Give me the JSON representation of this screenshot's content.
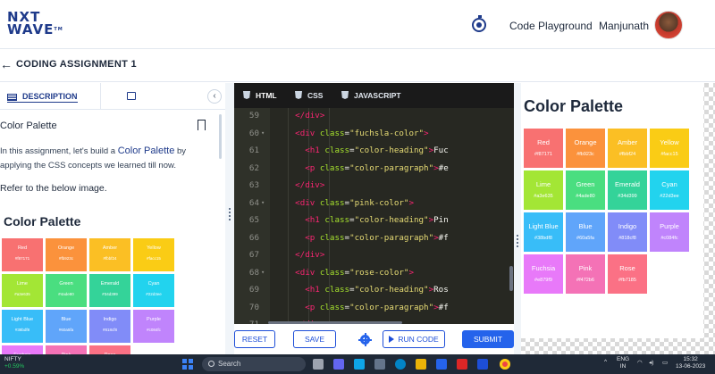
{
  "header": {
    "logo_line1": "NXT",
    "logo_line2": "WAVE",
    "logo_tm": "TM",
    "code_playground": "Code Playground",
    "user_name": "Manjunath"
  },
  "assignment": {
    "back": "←",
    "title": "CODING ASSIGNMENT 1"
  },
  "left_panel": {
    "tab_description": "DESCRIPTION",
    "collapse": "‹",
    "title": "Color Palette",
    "para_before": "In this assignment, let's build a ",
    "para_highlight": "Color Palette",
    "para_after": " by applying the CSS concepts we learned till now.",
    "refer": "Refer to the below image.",
    "preview_heading": "Color Palette"
  },
  "palette": [
    {
      "name": "Red",
      "code": "#f87171",
      "color": "#f87171"
    },
    {
      "name": "Orange",
      "code": "#fb923c",
      "color": "#fb923c"
    },
    {
      "name": "Amber",
      "code": "#fbbf24",
      "color": "#fbbf24"
    },
    {
      "name": "Yellow",
      "code": "#facc15",
      "color": "#facc15"
    },
    {
      "name": "Lime",
      "code": "#a3e635",
      "color": "#a3e635"
    },
    {
      "name": "Green",
      "code": "#4ade80",
      "color": "#4ade80"
    },
    {
      "name": "Emerald",
      "code": "#34d399",
      "color": "#34d399"
    },
    {
      "name": "Cyan",
      "code": "#22d3ee",
      "color": "#22d3ee"
    },
    {
      "name": "Light Blue",
      "code": "#38bdf8",
      "color": "#38bdf8"
    },
    {
      "name": "Blue",
      "code": "#60a5fa",
      "color": "#60a5fa"
    },
    {
      "name": "Indigo",
      "code": "#818cf8",
      "color": "#818cf8"
    },
    {
      "name": "Purple",
      "code": "#c084fc",
      "color": "#c084fc"
    },
    {
      "name": "Fuchsia",
      "code": "#e879f9",
      "color": "#e879f9"
    },
    {
      "name": "Pink",
      "code": "#f472b6",
      "color": "#f472b6"
    },
    {
      "name": "Rose",
      "code": "#fb7185",
      "color": "#fb7185"
    }
  ],
  "editor": {
    "tabs": [
      "HTML",
      "CSS",
      "JAVASCRIPT"
    ],
    "active_tab": "HTML",
    "lines": [
      {
        "n": "59",
        "indent": 4,
        "parts": [
          [
            "tg",
            "</"
          ],
          [
            "tg",
            "div"
          ],
          [
            "tg",
            ">"
          ]
        ],
        "fold": ""
      },
      {
        "n": "60",
        "indent": 4,
        "parts": [
          [
            "tg",
            "<"
          ],
          [
            "tg",
            "div"
          ],
          [
            "tx",
            " "
          ],
          [
            "at",
            "class"
          ],
          [
            "tx",
            "="
          ],
          [
            "st",
            "\"fuchsla-color\""
          ],
          [
            "tg",
            ">"
          ]
        ],
        "fold": "▾"
      },
      {
        "n": "61",
        "indent": 6,
        "parts": [
          [
            "tg",
            "<"
          ],
          [
            "tg",
            "h1"
          ],
          [
            "tx",
            " "
          ],
          [
            "at",
            "class"
          ],
          [
            "tx",
            "="
          ],
          [
            "st",
            "\"color-heading\""
          ],
          [
            "tg",
            ">"
          ],
          [
            "tx",
            "Fuc"
          ]
        ],
        "fold": ""
      },
      {
        "n": "62",
        "indent": 6,
        "parts": [
          [
            "tg",
            "<"
          ],
          [
            "tg",
            "p"
          ],
          [
            "tx",
            " "
          ],
          [
            "at",
            "class"
          ],
          [
            "tx",
            "="
          ],
          [
            "st",
            "\"color-paragraph\""
          ],
          [
            "tg",
            ">"
          ],
          [
            "tx",
            "#e"
          ]
        ],
        "fold": ""
      },
      {
        "n": "63",
        "indent": 4,
        "parts": [
          [
            "tg",
            "</"
          ],
          [
            "tg",
            "div"
          ],
          [
            "tg",
            ">"
          ]
        ],
        "fold": ""
      },
      {
        "n": "64",
        "indent": 4,
        "parts": [
          [
            "tg",
            "<"
          ],
          [
            "tg",
            "div"
          ],
          [
            "tx",
            " "
          ],
          [
            "at",
            "class"
          ],
          [
            "tx",
            "="
          ],
          [
            "st",
            "\"pink-color\""
          ],
          [
            "tg",
            ">"
          ]
        ],
        "fold": "▾"
      },
      {
        "n": "65",
        "indent": 6,
        "parts": [
          [
            "tg",
            "<"
          ],
          [
            "tg",
            "h1"
          ],
          [
            "tx",
            " "
          ],
          [
            "at",
            "class"
          ],
          [
            "tx",
            "="
          ],
          [
            "st",
            "\"color-heading\""
          ],
          [
            "tg",
            ">"
          ],
          [
            "tx",
            "Pin"
          ]
        ],
        "fold": ""
      },
      {
        "n": "66",
        "indent": 6,
        "parts": [
          [
            "tg",
            "<"
          ],
          [
            "tg",
            "p"
          ],
          [
            "tx",
            " "
          ],
          [
            "at",
            "class"
          ],
          [
            "tx",
            "="
          ],
          [
            "st",
            "\"color-paragraph\""
          ],
          [
            "tg",
            ">"
          ],
          [
            "tx",
            "#f"
          ]
        ],
        "fold": ""
      },
      {
        "n": "67",
        "indent": 4,
        "parts": [
          [
            "tg",
            "</"
          ],
          [
            "tg",
            "div"
          ],
          [
            "tg",
            ">"
          ]
        ],
        "fold": ""
      },
      {
        "n": "68",
        "indent": 4,
        "parts": [
          [
            "tg",
            "<"
          ],
          [
            "tg",
            "div"
          ],
          [
            "tx",
            " "
          ],
          [
            "at",
            "class"
          ],
          [
            "tx",
            "="
          ],
          [
            "st",
            "\"rose-color\""
          ],
          [
            "tg",
            ">"
          ]
        ],
        "fold": "▾"
      },
      {
        "n": "69",
        "indent": 6,
        "parts": [
          [
            "tg",
            "<"
          ],
          [
            "tg",
            "h1"
          ],
          [
            "tx",
            " "
          ],
          [
            "at",
            "class"
          ],
          [
            "tx",
            "="
          ],
          [
            "st",
            "\"color-heading\""
          ],
          [
            "tg",
            ">"
          ],
          [
            "tx",
            "Ros"
          ]
        ],
        "fold": ""
      },
      {
        "n": "70",
        "indent": 6,
        "parts": [
          [
            "tg",
            "<"
          ],
          [
            "tg",
            "p"
          ],
          [
            "tx",
            " "
          ],
          [
            "at",
            "class"
          ],
          [
            "tx",
            "="
          ],
          [
            "st",
            "\"color-paragraph\""
          ],
          [
            "tg",
            ">"
          ],
          [
            "tx",
            "#f"
          ]
        ],
        "fold": ""
      },
      {
        "n": "71",
        "indent": 4,
        "parts": [
          [
            "tg",
            "</"
          ],
          [
            "tg",
            "div"
          ],
          [
            "tg",
            ">"
          ]
        ],
        "fold": ""
      }
    ]
  },
  "buttons": {
    "reset": "RESET",
    "save": "SAVE",
    "run_code": "RUN CODE",
    "submit": "SUBMIT"
  },
  "preview": {
    "heading": "Color Palette"
  },
  "taskbar": {
    "nifty_label": "NIFTY",
    "nifty_change": "+0.59%",
    "search_placeholder": "Search",
    "lang": "ENG",
    "region": "IN",
    "time": "15:32",
    "date": "13-06-2023"
  }
}
